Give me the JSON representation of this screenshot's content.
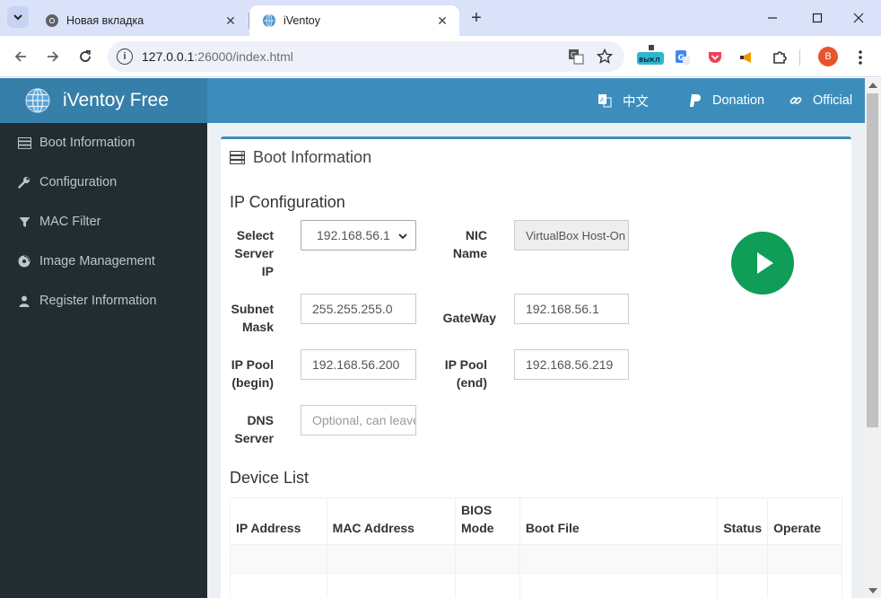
{
  "browser": {
    "tabs": [
      {
        "title": "Новая вкладка",
        "icon": "chrome-icon"
      },
      {
        "title": "iVentoy",
        "icon": "iventoy-globe-icon"
      }
    ],
    "url_host": "127.0.0.1",
    "url_path": ":26000/index.html",
    "extension_badge": "выкл",
    "profile_initial": "B"
  },
  "header": {
    "brand": "iVentoy Free",
    "links": [
      {
        "label": "中文",
        "icon": "language-icon"
      },
      {
        "label": "Donation",
        "icon": "paypal-icon"
      },
      {
        "label": "Official",
        "icon": "link-icon"
      }
    ]
  },
  "sidebar": {
    "items": [
      {
        "label": "Boot Information",
        "icon": "server-icon"
      },
      {
        "label": "Configuration",
        "icon": "wrench-icon"
      },
      {
        "label": "MAC Filter",
        "icon": "filter-icon"
      },
      {
        "label": "Image Management",
        "icon": "disc-icon"
      },
      {
        "label": "Register Information",
        "icon": "user-icon"
      }
    ]
  },
  "main": {
    "box_title": "Boot Information",
    "ip_config": {
      "title": "IP Configuration",
      "select_server_ip_label_1": "Select",
      "select_server_ip_label_2": "Server",
      "select_server_ip_label_3": "IP",
      "select_server_ip_value": "192.168.56.1",
      "nic_name_label_1": "NIC",
      "nic_name_label_2": "Name",
      "nic_name_value": "VirtualBox Host-On",
      "subnet_mask_label_1": "Subnet",
      "subnet_mask_label_2": "Mask",
      "subnet_mask_value": "255.255.255.0",
      "gateway_label": "GateWay",
      "gateway_value": "192.168.56.1",
      "ip_pool_begin_label_1": "IP Pool",
      "ip_pool_begin_label_2": "(begin)",
      "ip_pool_begin_value": "192.168.56.200",
      "ip_pool_end_label_1": "IP Pool",
      "ip_pool_end_label_2": "(end)",
      "ip_pool_end_value": "192.168.56.219",
      "dns_server_label_1": "DNS",
      "dns_server_label_2": "Server",
      "dns_server_placeholder": "Optional, can leave empty"
    },
    "device_list": {
      "title": "Device List",
      "columns": [
        "IP Address",
        "MAC Address",
        "BIOS Mode",
        "Boot File",
        "Status",
        "Operate"
      ]
    }
  },
  "colors": {
    "header": "#3c8dbc",
    "logo_bg": "#367fa9",
    "sidebar": "#222d32",
    "play": "#0f9d58"
  }
}
